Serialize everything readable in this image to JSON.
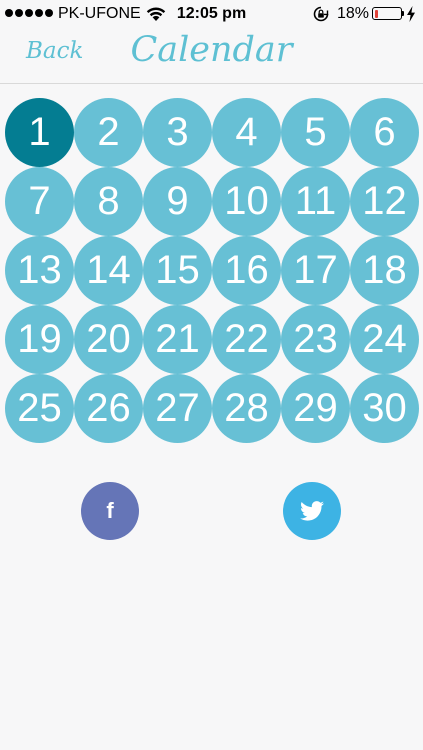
{
  "status_bar": {
    "carrier": "PK-UFONE",
    "time": "12:05 pm",
    "battery_percent": "18%",
    "battery_level": 0.18,
    "battery_color": "#e0433a"
  },
  "nav": {
    "back_label": "Back",
    "title": "Calendar"
  },
  "calendar": {
    "selected_day": 1,
    "selected_color": "#047d92",
    "day_color": "#67c0d5",
    "days": [
      "1",
      "2",
      "3",
      "4",
      "5",
      "6",
      "7",
      "8",
      "9",
      "10",
      "11",
      "12",
      "13",
      "14",
      "15",
      "16",
      "17",
      "18",
      "19",
      "20",
      "21",
      "22",
      "23",
      "24",
      "25",
      "26",
      "27",
      "28",
      "29",
      "30"
    ]
  },
  "social": {
    "facebook_glyph": "f",
    "facebook_color": "#6575b7",
    "twitter_color": "#3db3e4",
    "icons": [
      "facebook-icon",
      "twitter-icon"
    ]
  }
}
